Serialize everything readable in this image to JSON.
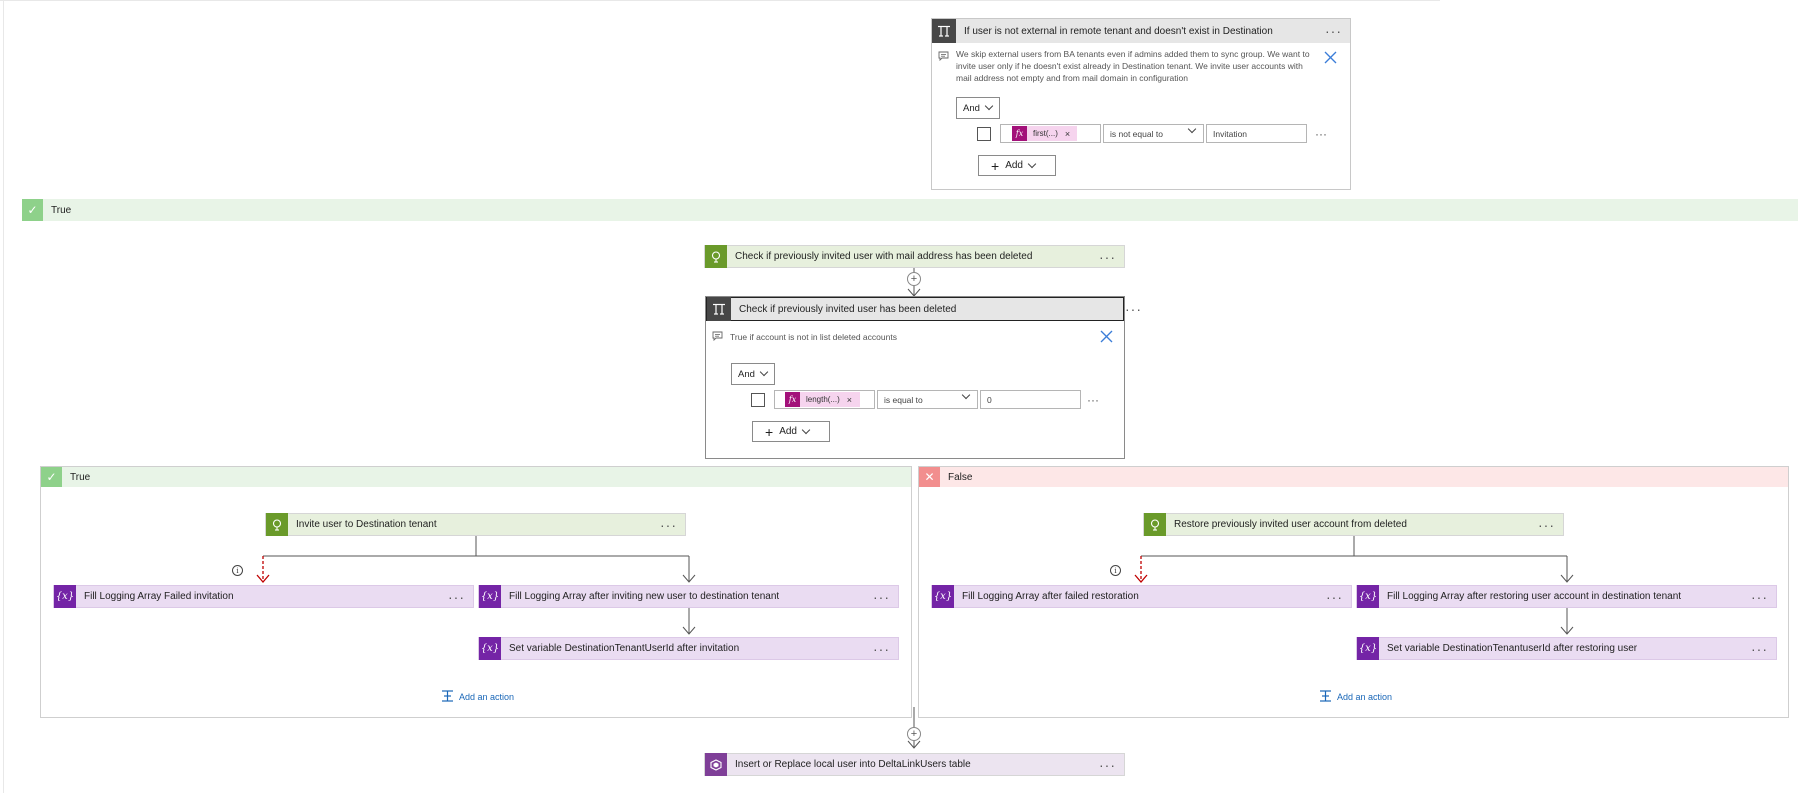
{
  "outer_condition": {
    "title": "If user is not external in remote tenant and doesn't exist in Destination",
    "note": "We skip external users from BA tenants even if admins added them to sync group. We want to invite user only if he doesn't exist already in Destination tenant. We invite user accounts with mail address not empty and from mail domain in configuration",
    "and_label": "And",
    "token_label": "first(...)",
    "operator": "is not equal to",
    "value": "Invitation",
    "add_label": "Add"
  },
  "outer_true_label": "True",
  "check_deleted_action": "Check if previously invited user with mail address has been deleted",
  "inner_condition": {
    "title": "Check if previously invited user has been deleted",
    "note": "True if account is not in list deleted accounts",
    "and_label": "And",
    "token_label": "length(...)",
    "operator": "is equal to",
    "value": "0",
    "add_label": "Add"
  },
  "true_branch": {
    "label": "True",
    "invite_action": "Invite user to Destination tenant",
    "fill_failed": "Fill Logging Array Failed invitation",
    "fill_success": "Fill Logging Array after inviting new user to destination tenant",
    "set_variable": "Set variable DestinationTenantUserId after invitation",
    "add_action": "Add an action"
  },
  "false_branch": {
    "label": "False",
    "restore_action": "Restore previously invited user account from deleted",
    "fill_failed": "Fill Logging Array after failed restoration",
    "fill_success": "Fill Logging Array after restoring user account in destination tenant",
    "set_variable": "Set variable DestinationTenantuserId after restoring user",
    "add_action": "Add an action"
  },
  "insert_action": "Insert or Replace local user into DeltaLinkUsers table",
  "icons": {
    "condition": "condition-icon",
    "variable": "variable-icon",
    "graph_request": "http-request-icon",
    "table": "azure-table-icon"
  },
  "colors": {
    "condition_header": "#e6e6e6",
    "true_branch": "#e8f4e7",
    "false_branch": "#fde7e7",
    "variable": "#7424a6",
    "http": "#6a9a2a",
    "link": "#1a67b8"
  }
}
